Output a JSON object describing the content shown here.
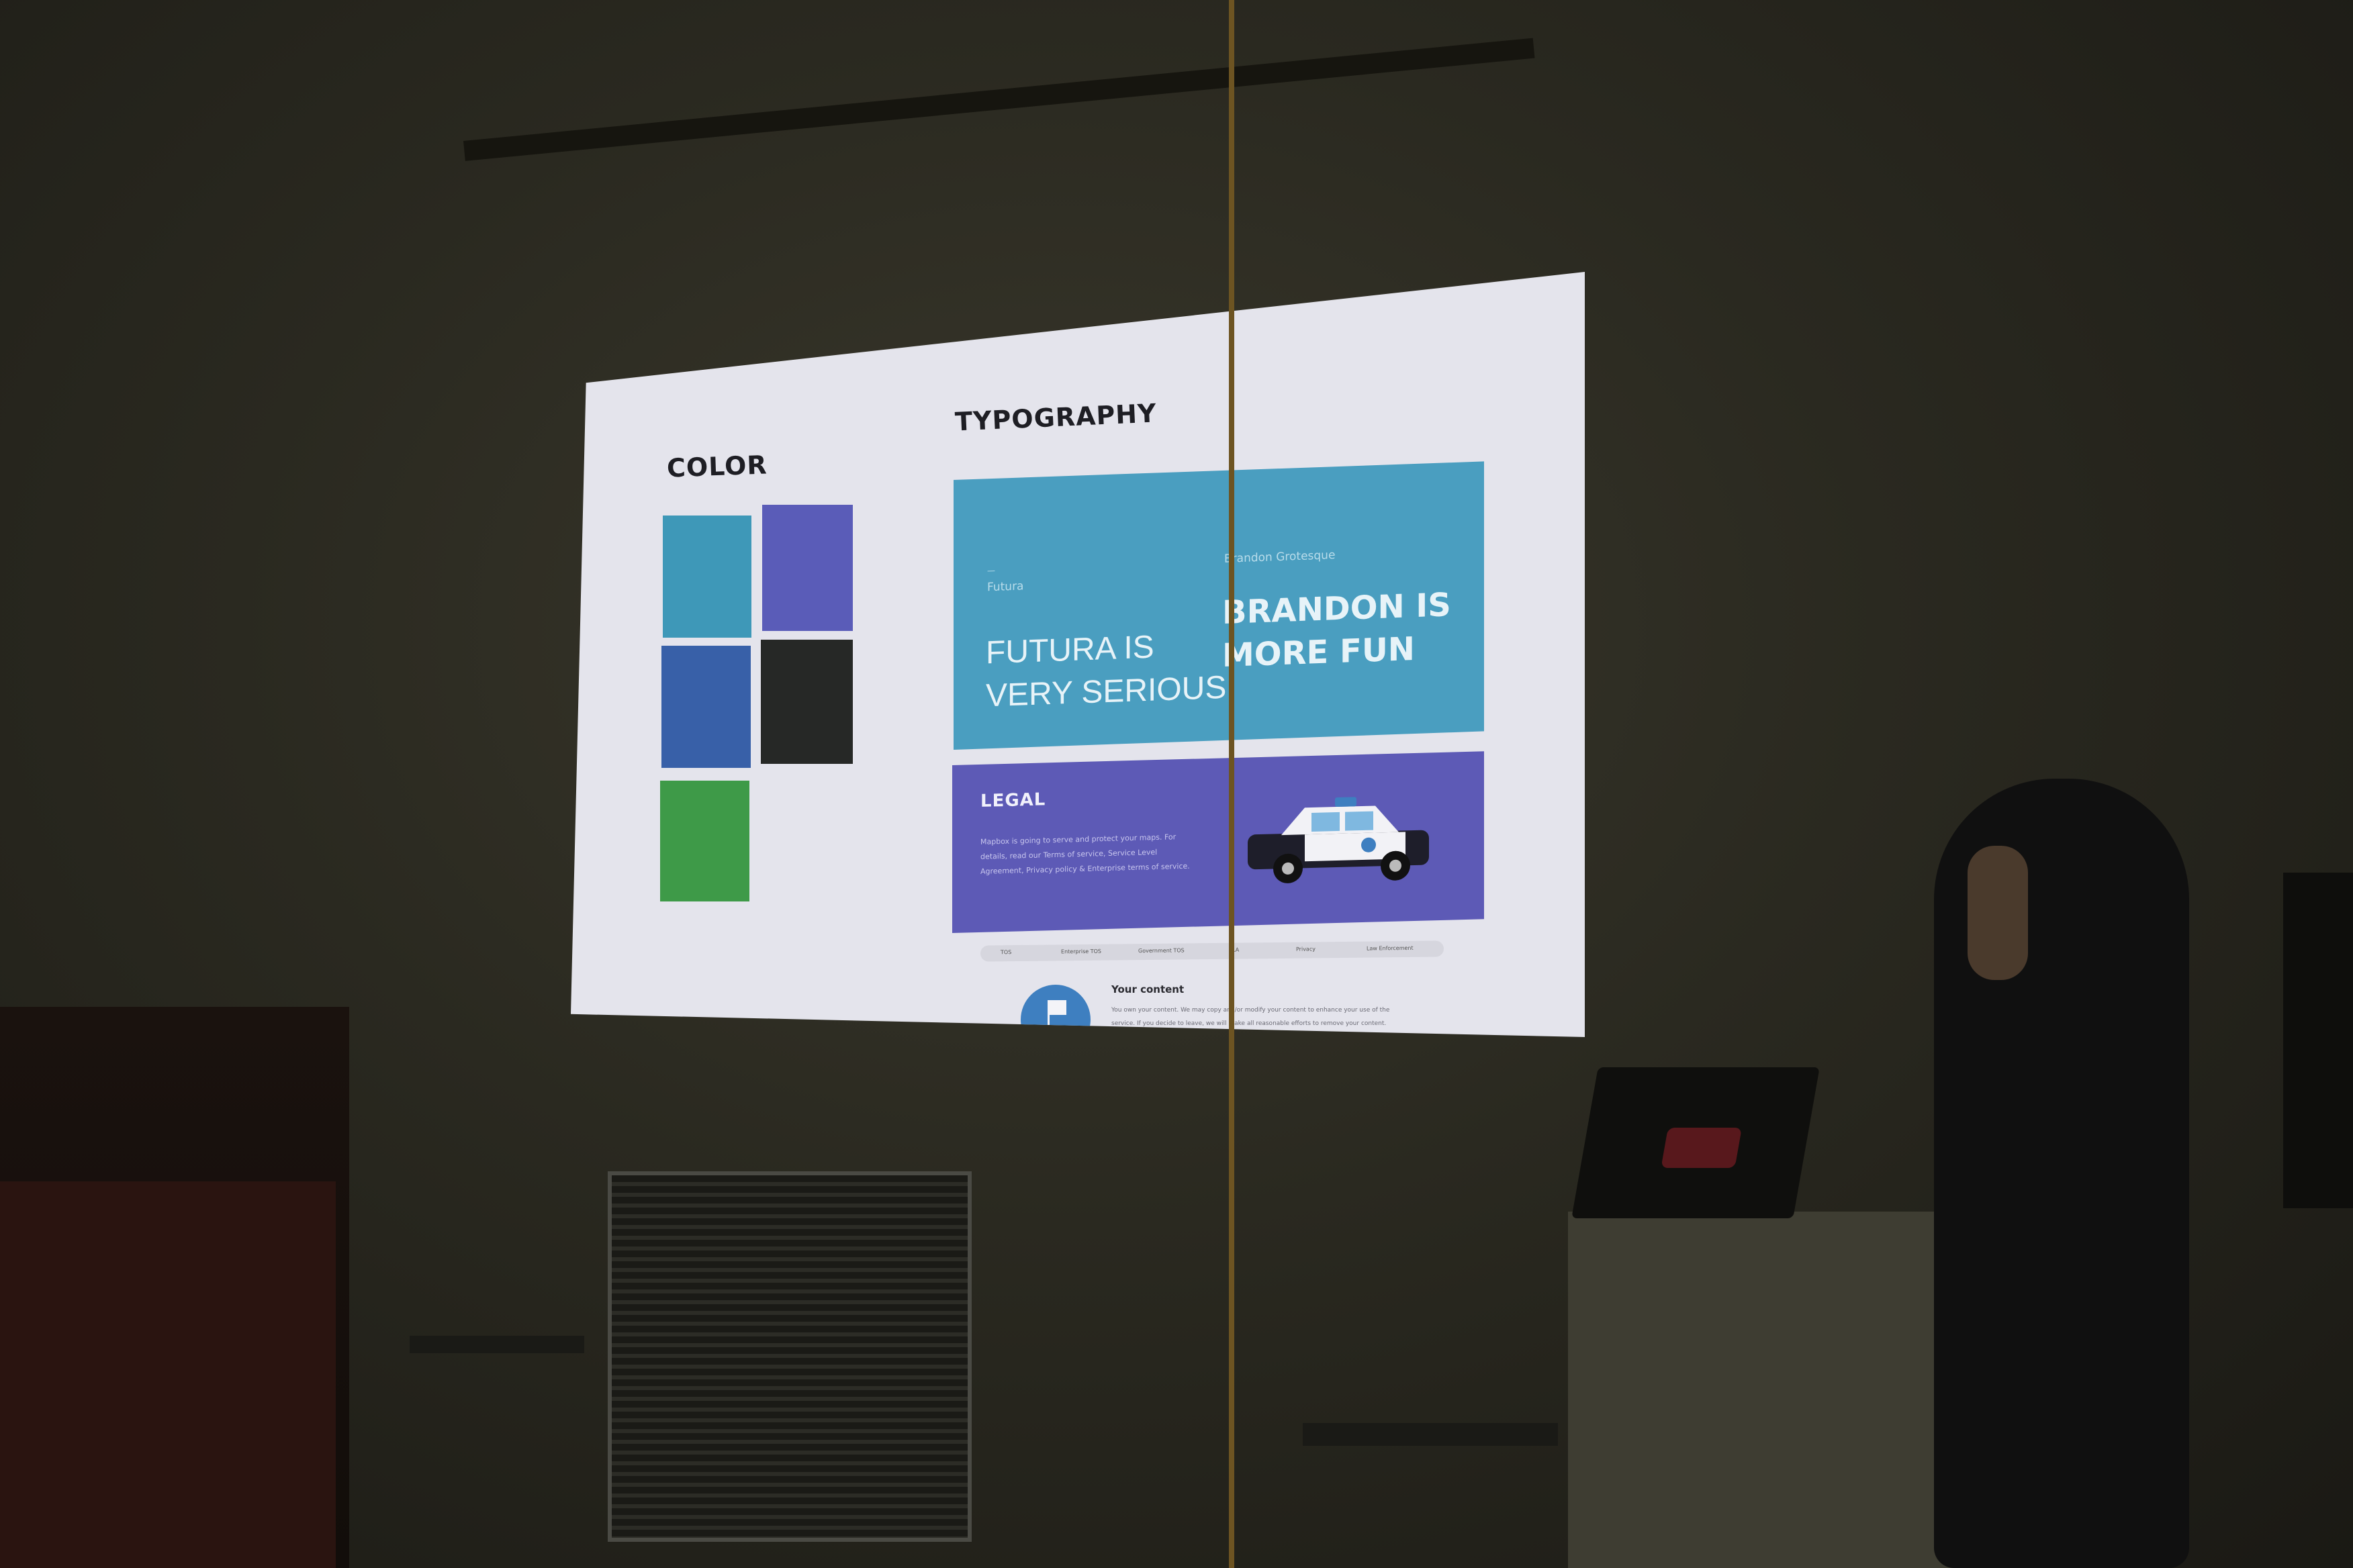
{
  "scene": {
    "description_colors": {
      "wall": "#2a2920",
      "cord": "#6d5422"
    }
  },
  "slide": {
    "color_heading": "COLOR",
    "typography_heading": "TYPOGRAPHY",
    "swatches": [
      "#3e98b8",
      "#5a5cb8",
      "#3860a8",
      "#262826",
      "#3e9a48"
    ],
    "typography_card": {
      "futura_label_small": "—",
      "futura_label": "Futura",
      "brandon_label": "Brandon Grotesque",
      "futura_text_line1": "FUTURA IS",
      "futura_text_line2": "VERY SERIOUS",
      "brandon_text_line1": "BRANDON IS",
      "brandon_text_line2": "MORE FUN"
    },
    "legal_card": {
      "title": "LEGAL",
      "body": "Mapbox is going to serve and protect your maps. For details, read our Terms of service, Service Level Agreement, Privacy policy & Enterprise terms of service."
    },
    "tabs": [
      "TOS",
      "Enterprise TOS",
      "Government TOS",
      "SLA",
      "Privacy",
      "Law Enforcement"
    ],
    "content_section": {
      "title": "Your content",
      "text": "You own your content. We may copy and/or modify your content to enhance your use of the service. If you decide to leave, we will make all reasonable efforts to remove your content."
    }
  }
}
